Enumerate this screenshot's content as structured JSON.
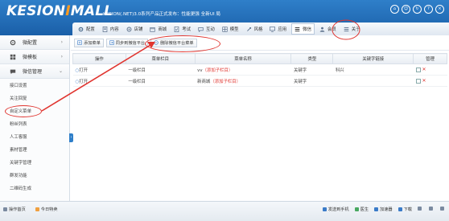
{
  "logo": {
    "prefix": "KESION",
    "highlight": "I",
    "suffix": "MALL"
  },
  "header": {
    "notice": "KESION(.NET)3.0系列产品正式发布：性能更强 全新UI 局",
    "window_icons": [
      "home-icon",
      "user-icon",
      "refresh-icon",
      "help-icon",
      "close-icon"
    ]
  },
  "nav": [
    {
      "label": "配置",
      "icon": "gear-icon",
      "color": "#4a6a8a"
    },
    {
      "label": "内容",
      "icon": "document-icon",
      "color": "#5a6f8a"
    },
    {
      "label": "店铺",
      "icon": "shop-icon",
      "color": "#5a6f8a"
    },
    {
      "label": "商城",
      "icon": "mall-icon",
      "color": "#5a6f8a"
    },
    {
      "label": "考试",
      "icon": "exam-icon",
      "color": "#5a6f8a"
    },
    {
      "label": "互动",
      "icon": "chat-icon",
      "color": "#5a6f8a"
    },
    {
      "label": "模型",
      "icon": "grid-icon",
      "color": "#5a6f8a"
    },
    {
      "label": "风格",
      "icon": "style-icon",
      "color": "#5a6f8a"
    },
    {
      "label": "应用",
      "icon": "monitor-icon",
      "color": "#5a6f8a"
    },
    {
      "label": "微信",
      "icon": "menu-icon",
      "color": "#333333"
    },
    {
      "label": "会员",
      "icon": "member-icon",
      "color": "#5a6f8a"
    },
    {
      "label": "关于",
      "icon": "about-icon",
      "color": "#5a6f8a"
    }
  ],
  "sidebar": {
    "sections": [
      {
        "label": "微配置",
        "icon": "gear-icon",
        "chevron": "›"
      },
      {
        "label": "微模板",
        "icon": "template-icon",
        "chevron": "›"
      },
      {
        "label": "微信管理",
        "icon": "wechat-icon",
        "chevron": "⌄"
      }
    ],
    "items": [
      "接口设置",
      "关注回复",
      "自定义菜单",
      "粉丝列表",
      "人工客服",
      "素材管理",
      "关键字管理",
      "群发功能",
      "二维码生成"
    ],
    "toggle": "‹"
  },
  "toolbar": {
    "add_menu": "添加菜单",
    "sync_menu": "同步到微信平台",
    "delete_platform_menu": "删除微信平台菜单"
  },
  "table": {
    "headers": [
      "操作",
      "菜单栏目",
      "菜单名称",
      "类型",
      "关键字链接",
      "管理"
    ],
    "rows": [
      {
        "op": "打开",
        "column": "一级栏目",
        "name": "vv",
        "add_sub": "（添加子栏目）",
        "type": "关键字",
        "keyword": "科兴"
      },
      {
        "op": "打开",
        "column": "一级栏目",
        "name": "新商城",
        "add_sub": "（添加子栏目）",
        "type": "关键字",
        "keyword": ""
      }
    ]
  },
  "status": {
    "left": [
      "操作首页",
      "今日特卖"
    ],
    "right": [
      "发送到手机",
      "医生",
      "加速器",
      "下载",
      "",
      "",
      "",
      ""
    ]
  },
  "colors": {
    "header": "#1f6ab6",
    "accent_orange": "#ff9a1f",
    "annotation_red": "#e0342f"
  }
}
